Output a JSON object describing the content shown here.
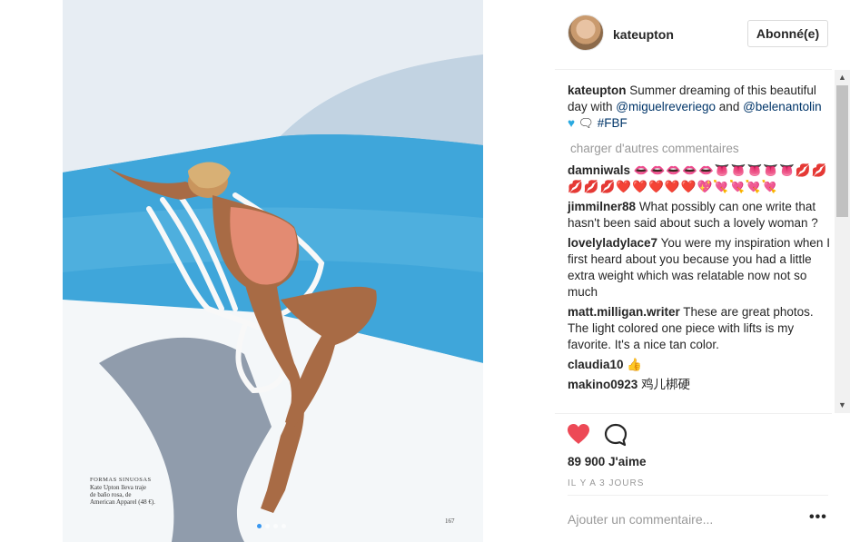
{
  "post": {
    "username": "kateupton",
    "follow_label": "Abonné(e)",
    "caption": {
      "username": "kateupton",
      "text_part1": " Summer dreaming of this beautiful day with ",
      "mention1": "@miguelreveriego",
      "text_part2": " and ",
      "mention2": "@belenantolin",
      "hashtag": "#FBF"
    },
    "load_more": "charger d'autres commentaires",
    "comments": [
      {
        "user": "damniwals",
        "text": "👄👄👄👄👄👅👅👅👅👅💋💋💋💋💋❤️❤️❤️❤️❤️💖💘💘💘💘"
      },
      {
        "user": "jimmilner88",
        "text": "What possibly can one write that hasn't been said about such a lovely woman ?"
      },
      {
        "user": "lovelyladylace7",
        "text": "You were my inspiration when I first heard about you because you had a little extra weight which was relatable now not so much"
      },
      {
        "user": "matt.milligan.writer",
        "text": "These are great photos. The light colored one piece with lifts is my favorite. It's a nice tan color."
      },
      {
        "user": "claudia10",
        "text": "👍"
      },
      {
        "user": "makino0923",
        "text": "鸡儿梆硬"
      }
    ],
    "likes": "89 900 J'aime",
    "time": "IL Y A 3 JOURS",
    "add_comment_placeholder": "Ajouter un commentaire...",
    "more_label": "•••",
    "photo_caption": {
      "title": "FORMAS SINUOSAS",
      "line1": "Kate Upton lleva traje",
      "line2": "de baño rosa, de",
      "line3": "American Apparel (48 €)."
    },
    "page_number": "167"
  },
  "colors": {
    "heart": "#ed4956",
    "mention": "#003569",
    "muted": "#999999",
    "pool": "#4fb0de"
  },
  "icons": {
    "like": "heart-icon",
    "comment": "speech-bubble-icon",
    "more": "ellipsis-icon"
  }
}
